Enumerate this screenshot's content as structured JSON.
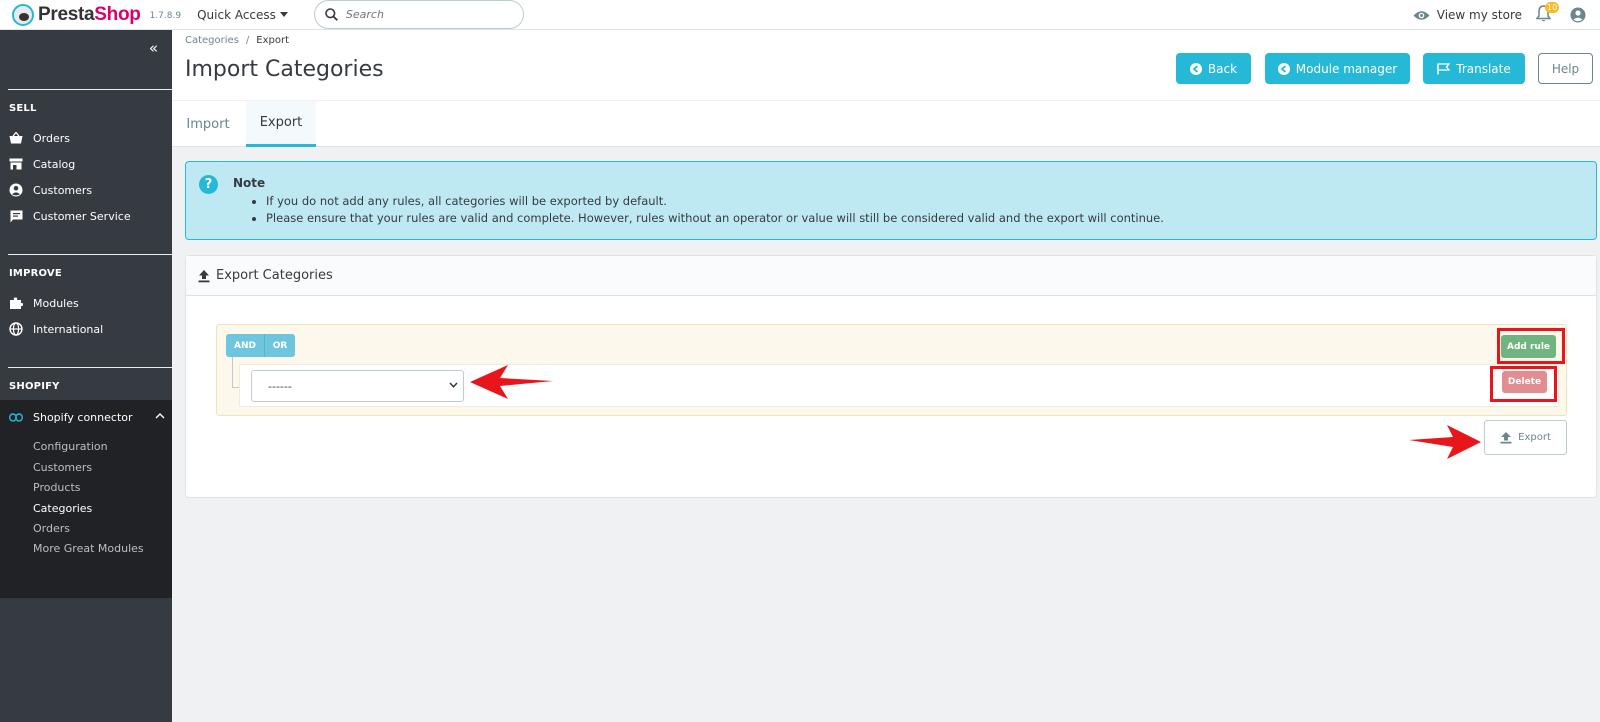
{
  "header": {
    "brand_part1": "Presta",
    "brand_part2": "Shop",
    "version": "1.7.8.9",
    "quick_access": "Quick Access",
    "search_placeholder": "Search",
    "view_store": "View my store",
    "notifications_count": "10"
  },
  "sidebar": {
    "sections": [
      {
        "title": "SELL",
        "items": [
          "Orders",
          "Catalog",
          "Customers",
          "Customer Service"
        ]
      },
      {
        "title": "IMPROVE",
        "items": [
          "Modules",
          "International"
        ]
      },
      {
        "title": "SHOPIFY",
        "items": [
          "Shopify connector"
        ]
      }
    ],
    "shopify_subitems": [
      "Configuration",
      "Customers",
      "Products",
      "Categories",
      "Orders",
      "More Great Modules"
    ],
    "active_subitem": "Categories"
  },
  "page": {
    "breadcrumb": [
      "Categories",
      "Export"
    ],
    "breadcrumb_sep": "/",
    "title": "Import Categories",
    "buttons": {
      "back": "Back",
      "module_manager": "Module manager",
      "translate": "Translate",
      "help": "Help"
    },
    "tabs": [
      "Import",
      "Export"
    ],
    "active_tab": "Export"
  },
  "note": {
    "title": "Note",
    "items": [
      "If you do not add any rules, all categories will be exported by default.",
      "Please ensure that your rules are valid and complete. However, rules without an operator or value will still be considered valid and the export will continue."
    ]
  },
  "export_card": {
    "title": "Export Categories",
    "and_label": "AND",
    "or_label": "OR",
    "select_value": "------",
    "add_rule": "Add rule",
    "delete": "Delete",
    "export": "Export"
  },
  "colors": {
    "accent": "#25b9d7",
    "sidebar_bg": "#363a41",
    "highlight": "#e8161b",
    "add_rule_green": "#70b580",
    "delete_red": "#e08e91"
  }
}
